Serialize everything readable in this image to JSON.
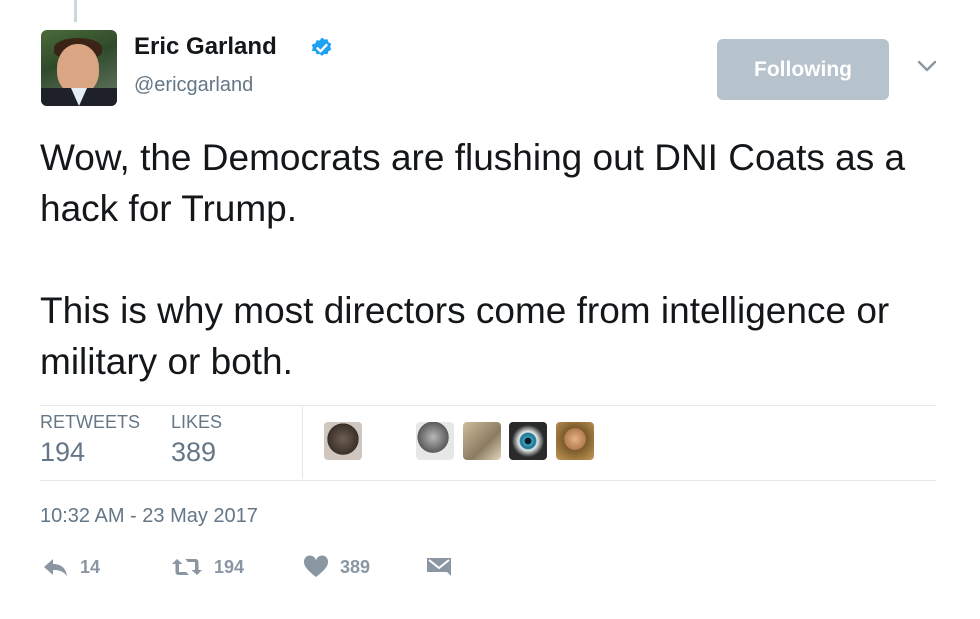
{
  "tweet": {
    "author_name": "Eric Garland",
    "handle": "@ericgarland",
    "follow_label": "Following",
    "paragraphs": [
      "Wow, the Democrats are flushing out DNI Coats as a hack for Trump.",
      "This is why most directors come from intelligence or military or both."
    ],
    "stats": {
      "retweets_label": "RETWEETS",
      "retweets_value": "194",
      "likes_label": "LIKES",
      "likes_value": "389"
    },
    "timestamp": "10:32 AM - 23 May 2017",
    "actions": {
      "reply_count": "14",
      "retweet_count": "194",
      "like_count": "389"
    }
  },
  "colors": {
    "verified": "#1da1f2",
    "follow_button": "#b6c2cc",
    "muted_text": "#657786",
    "action_icons": "#8a97a3"
  },
  "icons": [
    "verified-badge-icon",
    "chevron-down-icon",
    "reply-icon",
    "retweet-icon",
    "heart-icon",
    "direct-message-icon"
  ]
}
